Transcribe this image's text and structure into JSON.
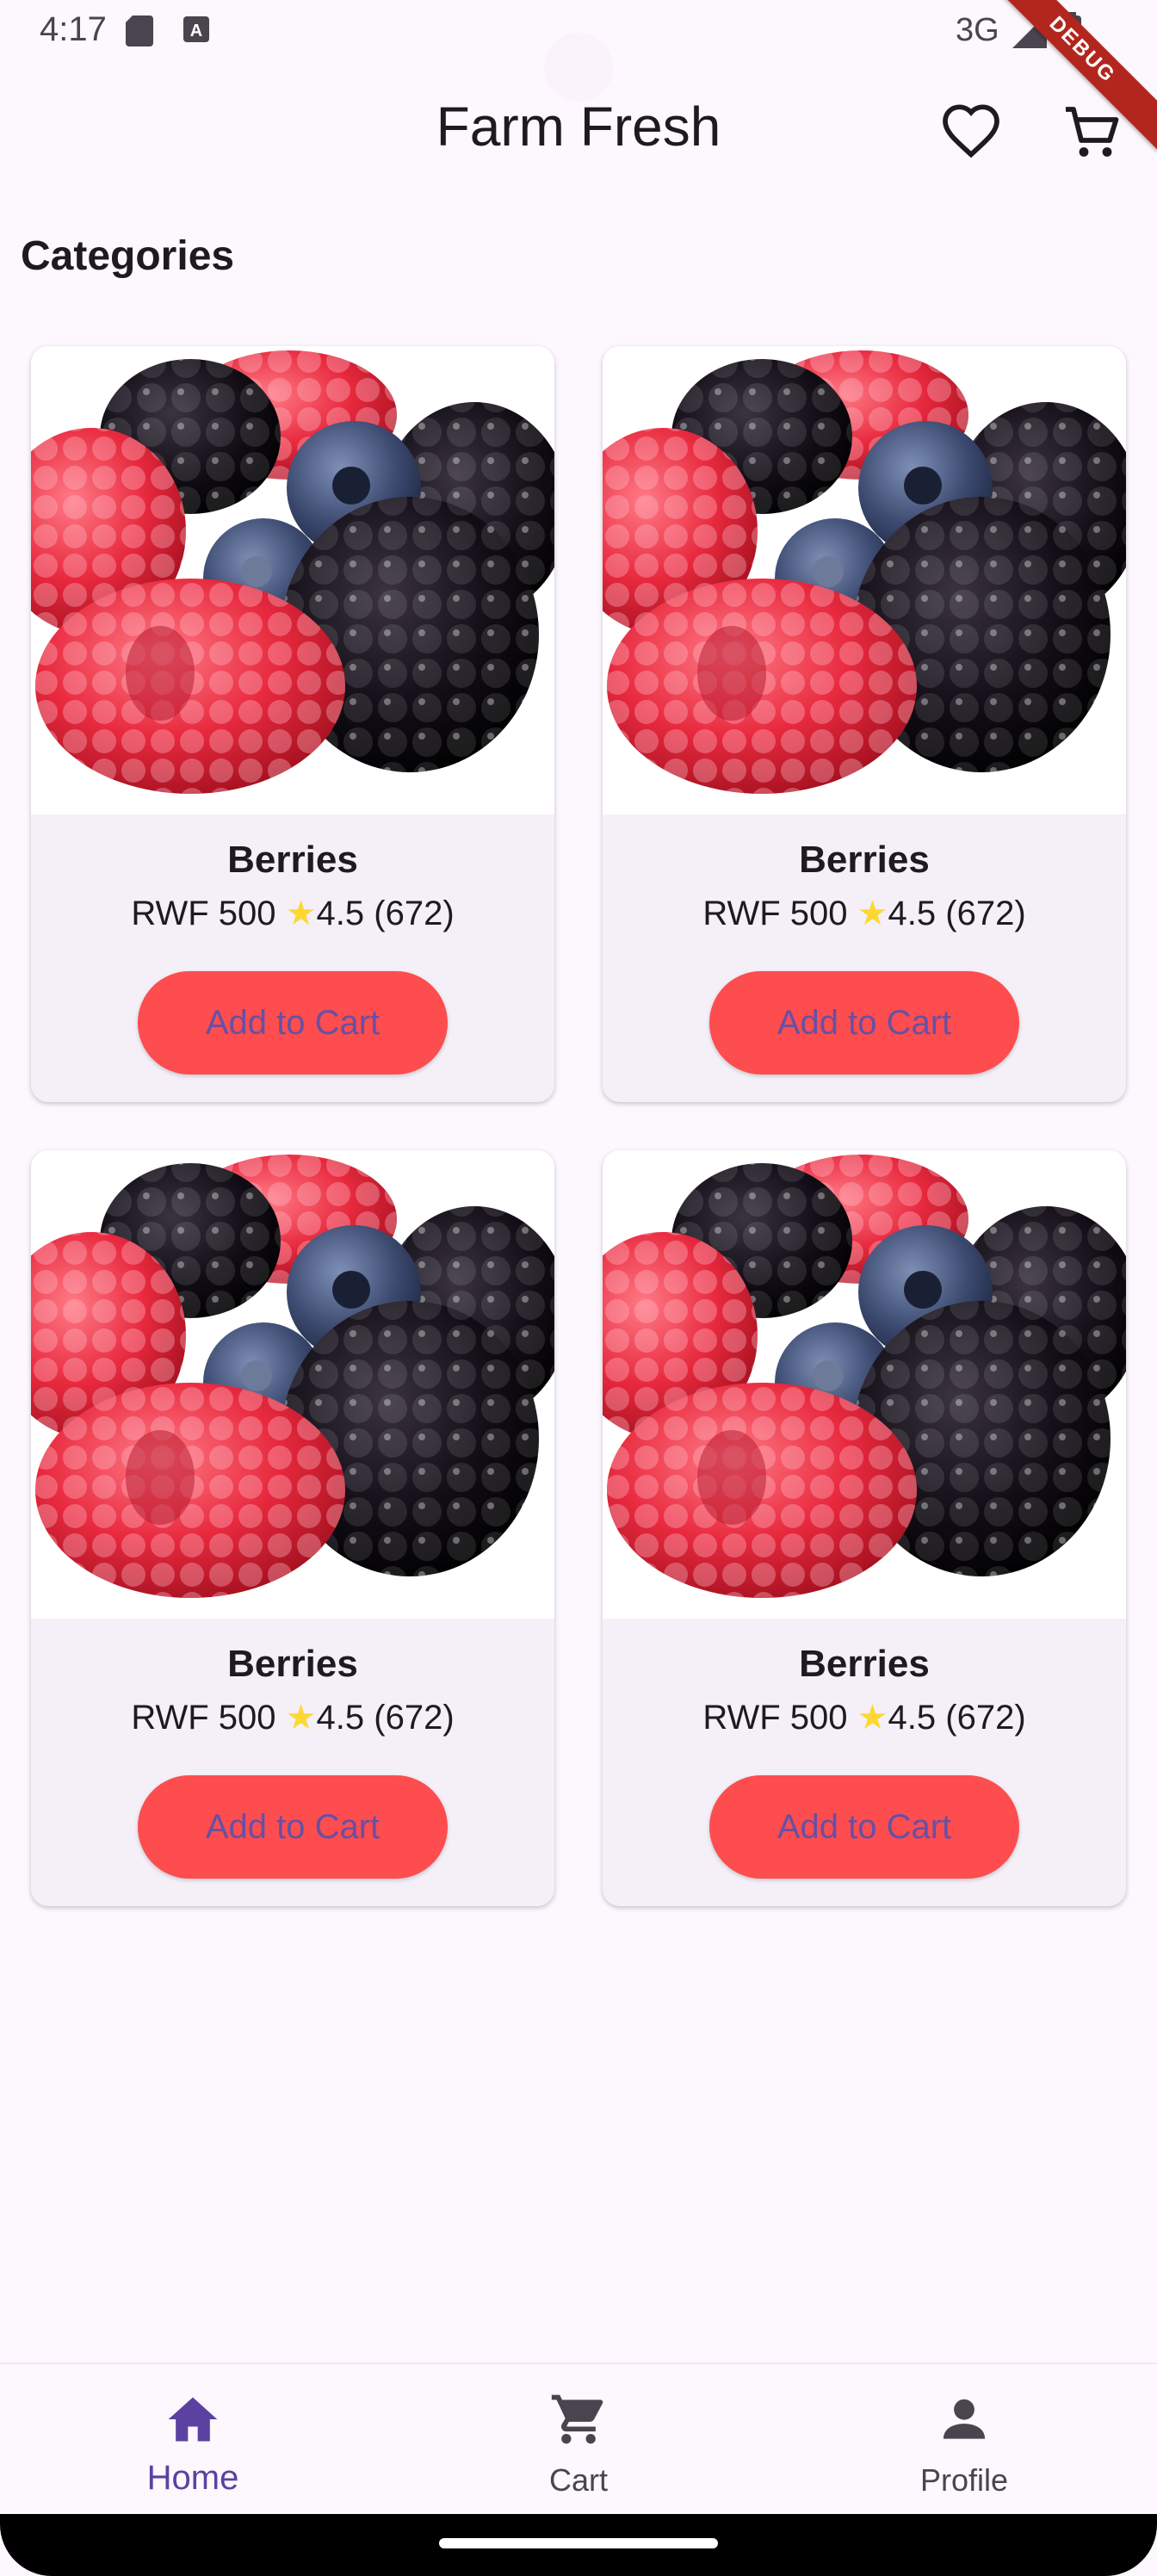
{
  "status_bar": {
    "time": "4:17",
    "network": "3G"
  },
  "debug_banner": "DEBUG",
  "app_bar": {
    "title": "Farm Fresh",
    "favorite_icon": "heart-outline-icon",
    "cart_icon": "cart-outline-icon"
  },
  "section": {
    "title": "Categories"
  },
  "products": [
    {
      "name": "Berries",
      "price": "RWF 500",
      "rating": "4.5",
      "reviews": "(672)",
      "button_label": "Add to Cart"
    },
    {
      "name": "Berries",
      "price": "RWF 500",
      "rating": "4.5",
      "reviews": "(672)",
      "button_label": "Add to Cart"
    },
    {
      "name": "Berries",
      "price": "RWF 500",
      "rating": "4.5",
      "reviews": "(672)",
      "button_label": "Add to Cart"
    },
    {
      "name": "Berries",
      "price": "RWF 500",
      "rating": "4.5",
      "reviews": "(672)",
      "button_label": "Add to Cart"
    }
  ],
  "bottom_nav": {
    "items": [
      {
        "label": "Home",
        "icon": "home-icon",
        "active": true
      },
      {
        "label": "Cart",
        "icon": "cart-icon",
        "active": false
      },
      {
        "label": "Profile",
        "icon": "person-icon",
        "active": false
      }
    ]
  },
  "colors": {
    "background": "#fdf7fe",
    "card": "#f5eff7",
    "button": "#fd4d4f",
    "button_text": "#6750a4",
    "nav_active": "#5b42a0",
    "star": "#fdd835"
  }
}
